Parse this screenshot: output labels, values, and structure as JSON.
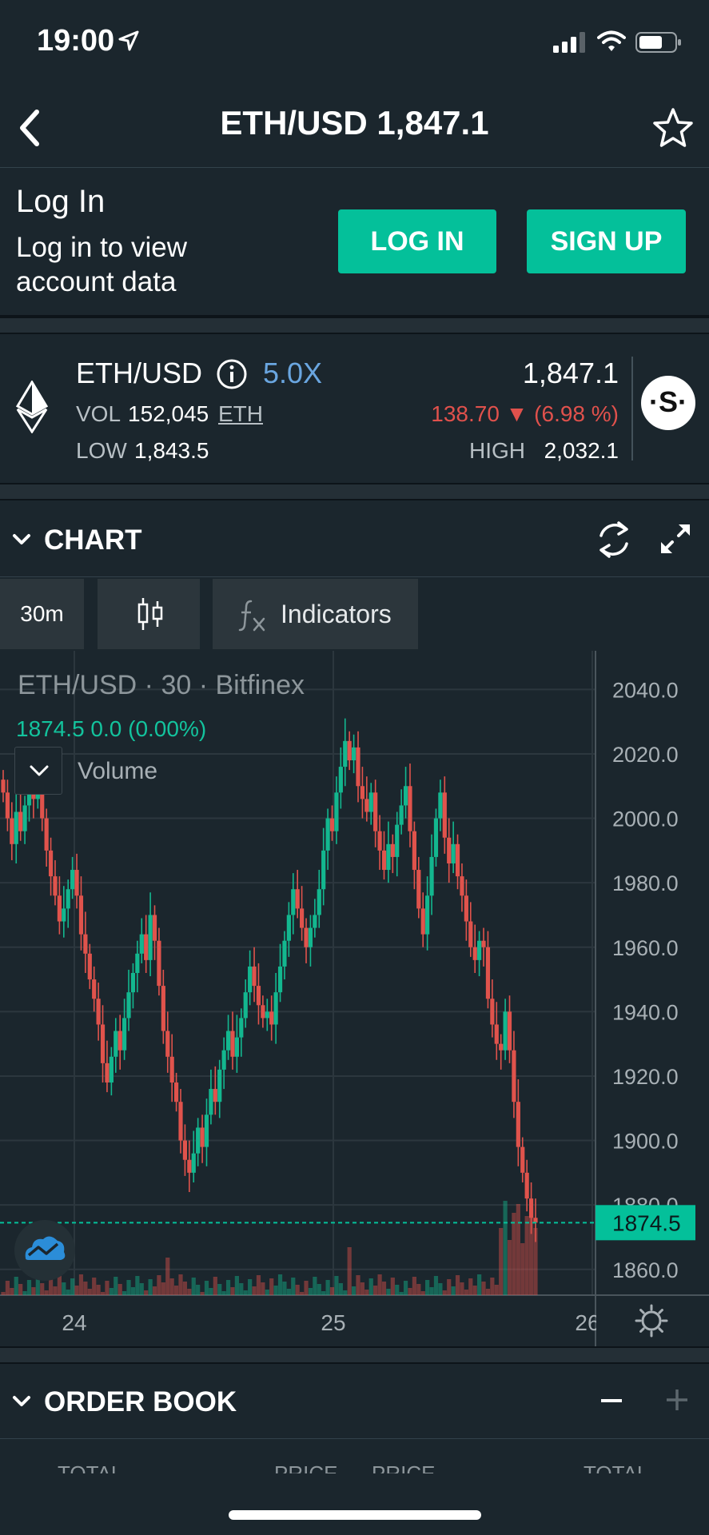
{
  "status_bar": {
    "time": "19:00"
  },
  "nav": {
    "title": "ETH/USD 1,847.1"
  },
  "login": {
    "heading": "Log In",
    "description": "Log in to view account data",
    "login_label": "LOG IN",
    "signup_label": "SIGN UP"
  },
  "ticker": {
    "pair": "ETH/USD",
    "leverage": "5.0X",
    "last_price": "1,847.1",
    "vol_label": "VOL",
    "vol_value": "152,045",
    "vol_unit": "ETH",
    "change": "138.70 ▼ (6.98 %)",
    "low_label": "LOW",
    "low_value": "1,843.5",
    "high_label": "HIGH",
    "high_value": "2,032.1"
  },
  "chart_section": {
    "title": "CHART",
    "interval": "30m",
    "indicators_label": "Indicators",
    "legend_title": "ETH/USD · 30 · Bitfinex",
    "legend_values": "1874.5  0.0 (0.00%)",
    "volume_label": "Volume"
  },
  "colors": {
    "up": "#13b78f",
    "down": "#e0534c",
    "accent": "#04c09a",
    "leverage": "#6aa6e0"
  },
  "chart_data": {
    "type": "candlestick",
    "title": "ETH/USD · 30 · Bitfinex",
    "x_ticks": [
      "24",
      "25",
      "26"
    ],
    "y_ticks": [
      2040.0,
      2020.0,
      2000.0,
      1980.0,
      1960.0,
      1940.0,
      1920.0,
      1900.0,
      1880.0,
      1860.0
    ],
    "ylim": [
      1852,
      2052
    ],
    "last_price_label": "1874.5",
    "last_price": 1874.5,
    "close_series": [
      2008,
      2000,
      1992,
      2002,
      1996,
      2004,
      2012,
      2006,
      2014,
      2000,
      1990,
      1982,
      1976,
      1968,
      1972,
      1978,
      1984,
      1976,
      1964,
      1958,
      1950,
      1944,
      1936,
      1924,
      1918,
      1926,
      1934,
      1928,
      1938,
      1946,
      1952,
      1958,
      1964,
      1956,
      1970,
      1962,
      1948,
      1934,
      1926,
      1918,
      1912,
      1900,
      1894,
      1890,
      1896,
      1904,
      1898,
      1908,
      1916,
      1912,
      1922,
      1928,
      1934,
      1926,
      1932,
      1938,
      1946,
      1954,
      1948,
      1942,
      1938,
      1940,
      1936,
      1946,
      1954,
      1962,
      1970,
      1978,
      1972,
      1966,
      1960,
      1966,
      1970,
      1978,
      1990,
      2000,
      1996,
      2008,
      2016,
      2024,
      2018,
      2022,
      2010,
      2006,
      2002,
      2008,
      1996,
      1990,
      1984,
      1992,
      1988,
      1998,
      2004,
      2010,
      1996,
      1984,
      1972,
      1964,
      1976,
      1988,
      2000,
      2008,
      1994,
      1986,
      1992,
      1982,
      1976,
      1968,
      1960,
      1956,
      1962,
      1960,
      1944,
      1936,
      1930,
      1928,
      1940,
      1928,
      1912,
      1898,
      1890,
      1882,
      1876,
      1874.5
    ],
    "volume_bars_count": 124
  },
  "orderbook": {
    "title": "ORDER BOOK",
    "col_total": "TOTAL",
    "col_price": "PRICE"
  }
}
